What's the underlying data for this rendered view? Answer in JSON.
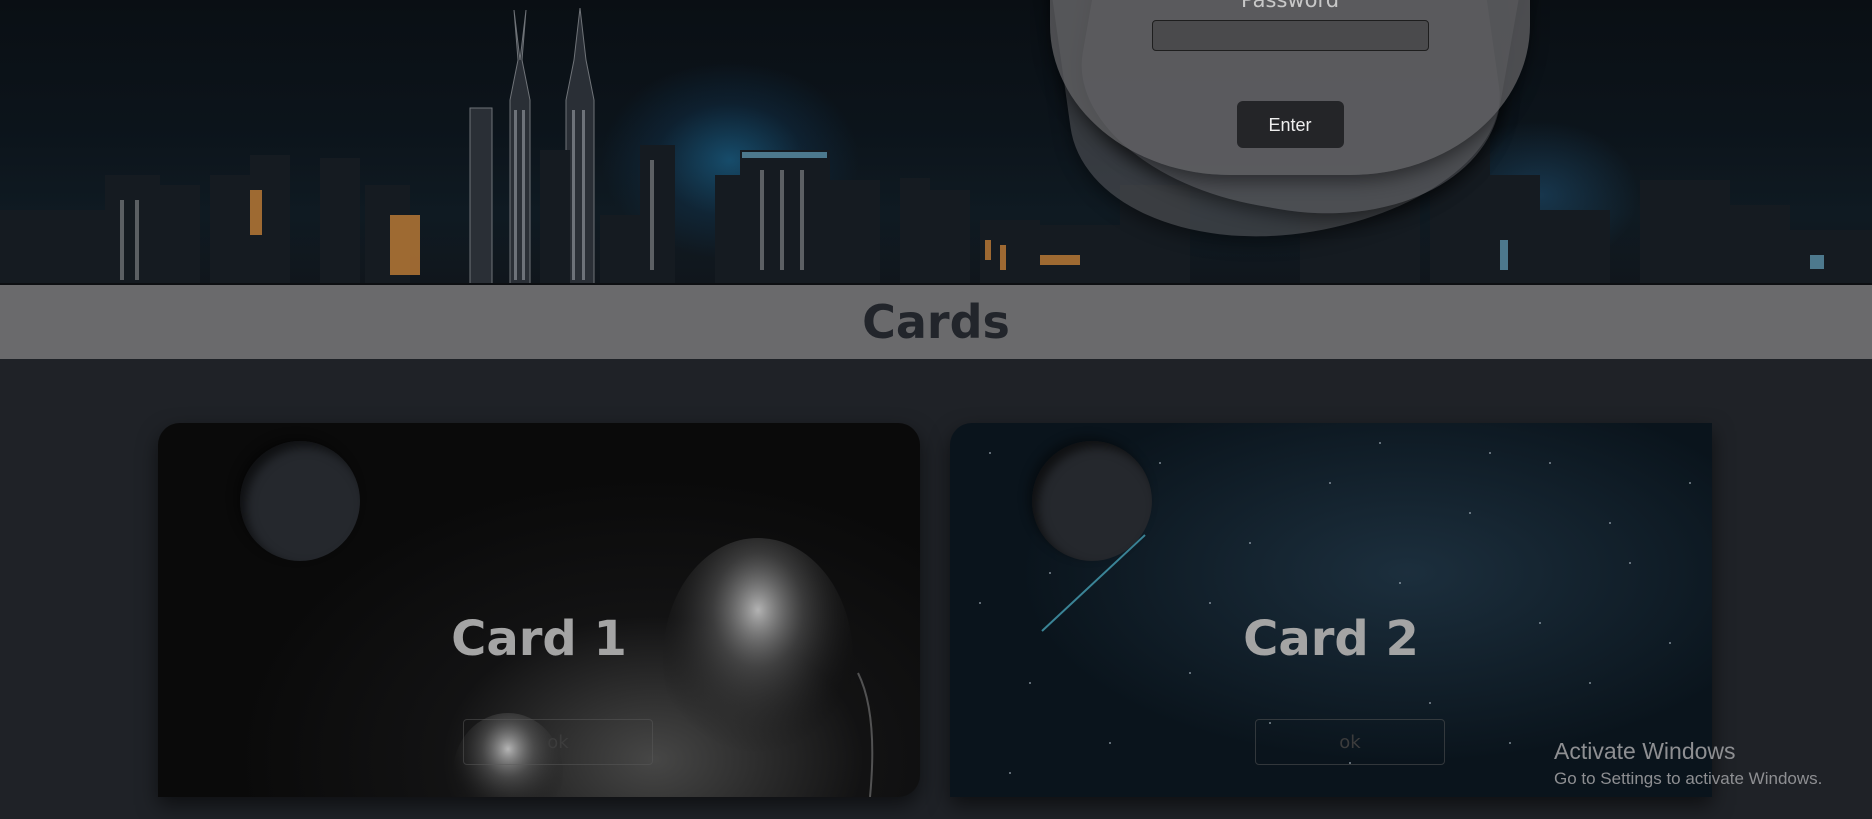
{
  "login": {
    "password_label": "Password",
    "password_value": "",
    "enter_label": "Enter"
  },
  "section": {
    "title": "Cards"
  },
  "cards": [
    {
      "title": "Card 1",
      "button_label": "ok"
    },
    {
      "title": "Card 2",
      "button_label": "ok"
    }
  ],
  "watermark": {
    "title": "Activate Windows",
    "subtitle": "Go to Settings to activate Windows."
  },
  "colors": {
    "page_bg": "#1f2227",
    "section_bar": "#6a6a6c",
    "section_title": "#22252b",
    "enter_button": "#242528"
  }
}
